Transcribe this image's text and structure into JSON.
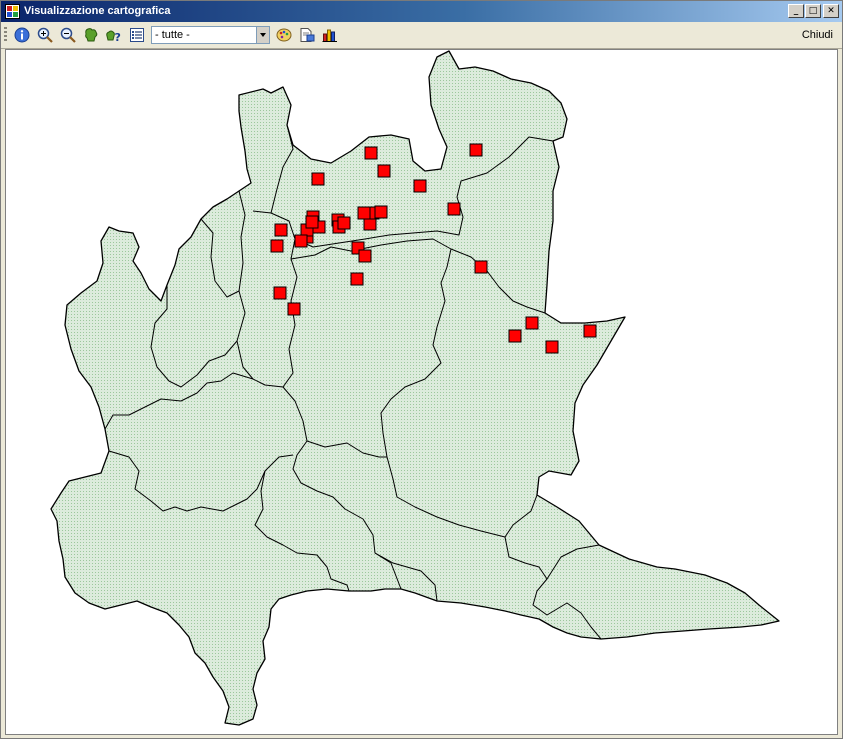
{
  "window": {
    "title": "Visualizzazione cartografica",
    "controls": {
      "minimize": "_",
      "maximize": "□",
      "close": "✕"
    }
  },
  "toolbar": {
    "buttons": [
      {
        "name": "info",
        "icon": "info-icon"
      },
      {
        "name": "zoom-in",
        "icon": "zoom-in-icon"
      },
      {
        "name": "zoom-out",
        "icon": "zoom-out-icon"
      },
      {
        "name": "pan",
        "icon": "pan-icon"
      },
      {
        "name": "identify",
        "icon": "identify-icon"
      },
      {
        "name": "layers",
        "icon": "list-icon"
      }
    ],
    "filter": {
      "selected": "- tutte -"
    },
    "buttons_right": [
      {
        "name": "palette",
        "icon": "palette-icon"
      },
      {
        "name": "export",
        "icon": "export-icon"
      },
      {
        "name": "chart",
        "icon": "chart-icon"
      }
    ],
    "close_label": "Chiudi"
  },
  "map": {
    "region_fill": "#d8e8d8",
    "border_color": "#000000",
    "marker_color": "#ff0000",
    "marker_count": 33
  }
}
